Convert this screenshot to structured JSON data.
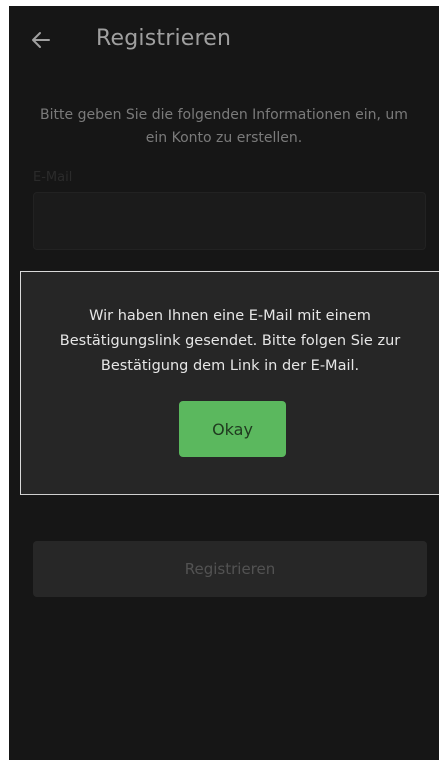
{
  "header": {
    "title": "Registrieren",
    "back_icon": "arrow-left-icon"
  },
  "form": {
    "intro_line1": "Bitte geben Sie die folgenden Informationen ein, um",
    "intro_line2": "ein Konto zu erstellen.",
    "email_label": "E-Mail",
    "email_value": "",
    "submit_label": "Registrieren"
  },
  "dialog": {
    "message_line1": "Wir haben Ihnen eine E-Mail mit einem",
    "message_line2": "Bestätigungslink gesendet. Bitte folgen Sie zur",
    "message_line3": "Bestätigung dem Link in der E-Mail.",
    "ok_label": "Okay"
  },
  "colors": {
    "background": "#1e1e1e",
    "accent_green": "#5bb85e",
    "dialog_background": "#262626"
  }
}
